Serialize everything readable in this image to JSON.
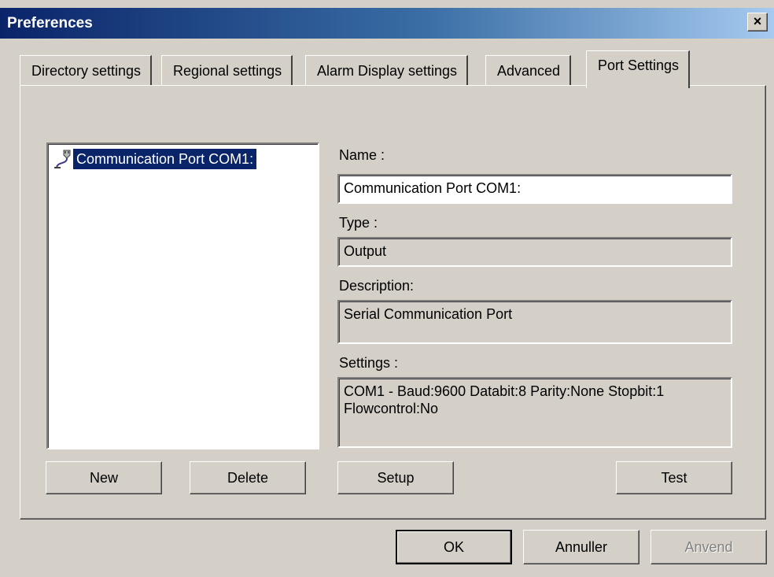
{
  "window": {
    "title": "Preferences",
    "close_glyph": "×"
  },
  "tabs": [
    {
      "label": "Directory settings"
    },
    {
      "label": "Regional settings"
    },
    {
      "label": "Alarm Display settings"
    },
    {
      "label": "Advanced"
    },
    {
      "label": "Port Settings",
      "active": true
    }
  ],
  "port_list": {
    "items": [
      {
        "label": "Communication Port COM1:",
        "icon": "serial-port-icon",
        "selected": true
      }
    ]
  },
  "form": {
    "name_label": "Name :",
    "name_value": "Communication Port COM1:",
    "type_label": "Type :",
    "type_value": "Output",
    "description_label": "Description:",
    "description_value": "Serial Communication Port",
    "settings_label": "Settings :",
    "settings_line1": "COM1 - Baud:9600 Databit:8 Parity:None Stopbit:1",
    "settings_line2": "Flowcontrol:No"
  },
  "panel_buttons": {
    "new": "New",
    "delete": "Delete",
    "setup": "Setup",
    "test": "Test"
  },
  "dialog_buttons": {
    "ok": "OK",
    "cancel": "Annuller",
    "apply": "Anvend"
  },
  "colors": {
    "face": "#d4d0c8",
    "title_start": "#0a246a",
    "selection": "#0a246a"
  }
}
